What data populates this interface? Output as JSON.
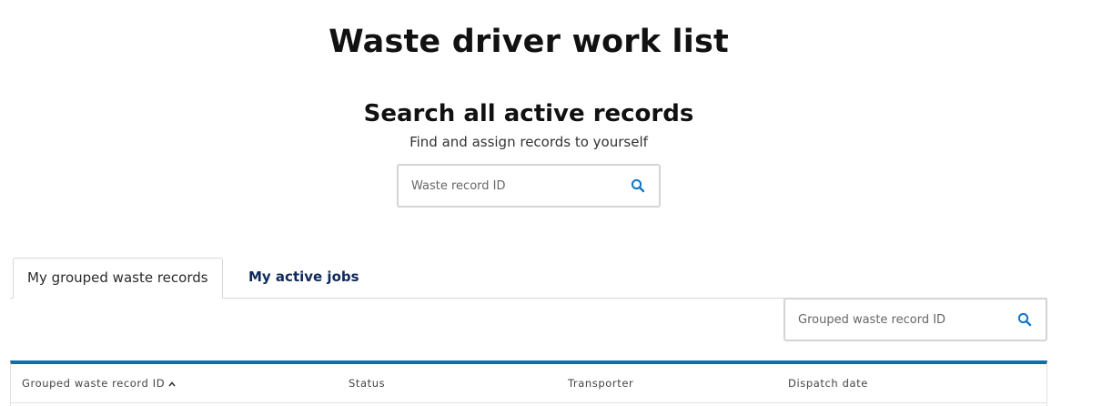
{
  "page": {
    "title": "Waste driver work list"
  },
  "search": {
    "heading": "Search all active records",
    "subheading": "Find and assign records to yourself",
    "placeholder": "Waste record ID",
    "icon": "search-icon"
  },
  "tabs": [
    {
      "label": "My grouped waste records",
      "active": true
    },
    {
      "label": "My active jobs",
      "active": false
    }
  ],
  "group_search": {
    "placeholder": "Grouped waste record ID",
    "icon": "search-icon"
  },
  "table": {
    "columns": [
      {
        "label": "Grouped waste record ID",
        "sort": "ascending",
        "sort_icon": "chevron-up-icon"
      },
      {
        "label": "Status"
      },
      {
        "label": "Transporter"
      },
      {
        "label": "Dispatch date"
      }
    ]
  },
  "colors": {
    "accent": "#0b6fb0",
    "icon": "#1477c2",
    "tab_inactive_text": "#0f2a5a"
  }
}
